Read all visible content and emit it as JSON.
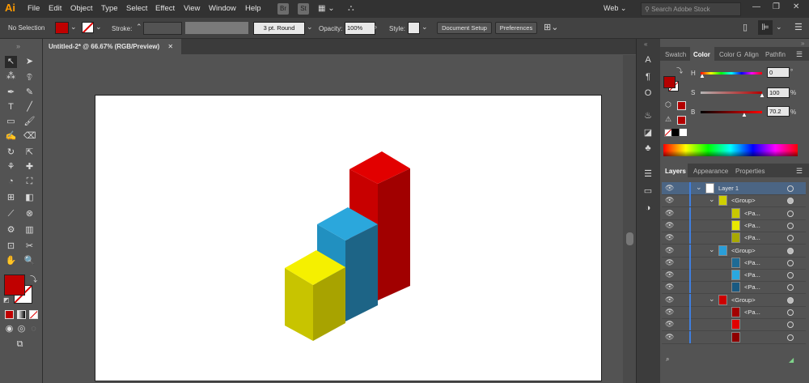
{
  "app": {
    "logo": "Ai",
    "accent": "#ff9a00"
  },
  "menu": {
    "items": [
      "File",
      "Edit",
      "Object",
      "Type",
      "Select",
      "Effect",
      "View",
      "Window",
      "Help"
    ]
  },
  "menubar_icons": [
    "Br",
    "St"
  ],
  "workspace": "Web",
  "search": {
    "placeholder": "Search Adobe Stock"
  },
  "window_controls": [
    "—",
    "❐",
    "✕"
  ],
  "control_bar": {
    "selection": "No Selection",
    "fill_color": "#c00000",
    "stroke_label": "Stroke:",
    "brush": "3 pt. Round",
    "opacity_label": "Opacity:",
    "opacity_value": "100%",
    "style_label": "Style:",
    "document_setup": "Document Setup",
    "preferences": "Preferences"
  },
  "document_tab": {
    "title": "Untitled-2* @ 66.67% (RGB/Preview)",
    "close": "✕"
  },
  "color_panel": {
    "tabs": [
      "Swatch",
      "Color",
      "Color G",
      "Align",
      "Pathfin"
    ],
    "active_tab": "Color",
    "h": {
      "label": "H",
      "value": "0",
      "unit": "°"
    },
    "s": {
      "label": "S",
      "value": "100",
      "unit": "%"
    },
    "b": {
      "label": "B",
      "value": "70.2",
      "unit": "%"
    },
    "swatch_color": "#b30000"
  },
  "layers_panel": {
    "tabs": [
      "Layers",
      "Appearance",
      "Properties"
    ],
    "active_tab": "Layers",
    "rows": [
      {
        "name": "Layer 1",
        "indent": 0,
        "expand": "⌄",
        "thumb": "#ffffff",
        "selected": true
      },
      {
        "name": "<Group>",
        "indent": 1,
        "expand": "⌄",
        "thumb": "#cfcf00"
      },
      {
        "name": "<Pa...",
        "indent": 2,
        "expand": "",
        "thumb": "#c9c900"
      },
      {
        "name": "<Pa...",
        "indent": 2,
        "expand": "",
        "thumb": "#e8e800"
      },
      {
        "name": "<Pa...",
        "indent": 2,
        "expand": "",
        "thumb": "#a9a900"
      },
      {
        "name": "<Group>",
        "indent": 1,
        "expand": "⌄",
        "thumb": "#2a9ed8"
      },
      {
        "name": "<Pa...",
        "indent": 2,
        "expand": "",
        "thumb": "#1f6b95"
      },
      {
        "name": "<Pa...",
        "indent": 2,
        "expand": "",
        "thumb": "#2aa8e0"
      },
      {
        "name": "<Pa...",
        "indent": 2,
        "expand": "",
        "thumb": "#1a5a82"
      },
      {
        "name": "<Group>",
        "indent": 1,
        "expand": "⌄",
        "thumb": "#cc0000"
      },
      {
        "name": "<Pa...",
        "indent": 2,
        "expand": "",
        "thumb": "#a30000"
      },
      {
        "name": "",
        "indent": 2,
        "expand": "",
        "thumb": "#e00000"
      },
      {
        "name": "",
        "indent": 2,
        "expand": "",
        "thumb": "#8f0000"
      }
    ]
  },
  "artwork": {
    "colors": {
      "yellow_top": "#f5f000",
      "yellow_left": "#c8c400",
      "yellow_right": "#a8a300",
      "blue_top": "#2ba7dc",
      "blue_left": "#2190c0",
      "blue_right": "#1d6486",
      "red_top": "#e20000",
      "red_left": "#c80000",
      "red_right": "#a10000"
    }
  }
}
